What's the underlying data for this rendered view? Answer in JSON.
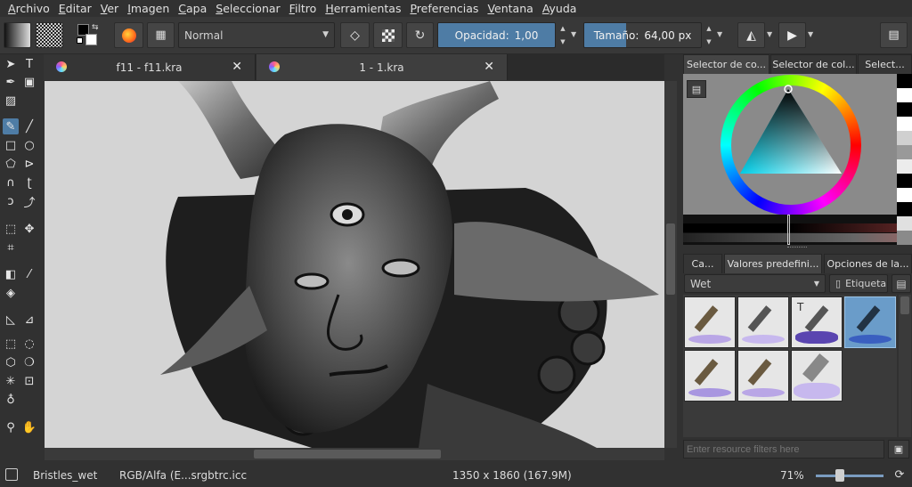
{
  "menu": [
    "Archivo",
    "Editar",
    "Ver",
    "Imagen",
    "Capa",
    "Seleccionar",
    "Filtro",
    "Herramientas",
    "Preferencias",
    "Ventana",
    "Ayuda"
  ],
  "toolbar": {
    "blend_mode": "Normal",
    "opacity_label": "Opacidad:",
    "opacity_value": "1,00",
    "opacity_fraction": 1.0,
    "size_label": "Tamaño:",
    "size_value": "64,00 px",
    "size_fraction": 0.36
  },
  "tabs": [
    {
      "title": "f11 - f11.kra",
      "active": false
    },
    {
      "title": "1 - 1.kra",
      "active": true
    }
  ],
  "color_dockers": [
    "Selector de co...",
    "Selector de col...",
    "Select..."
  ],
  "lower_dockers": [
    "Ca...",
    "Valores predefini...",
    "Opciones de la..."
  ],
  "presets": {
    "tag": "Wet",
    "tag_label": "Etiqueta",
    "filter_placeholder": "Enter resource filters here"
  },
  "status": {
    "brush": "Bristles_wet",
    "colorspace": "RGB/Alfa (E...srgbtrc.icc",
    "dimensions": "1350 x 1860 (167.9M)",
    "zoom": "71%"
  },
  "colors": {
    "accent": "#4e7ca5",
    "panel": "#313131"
  }
}
